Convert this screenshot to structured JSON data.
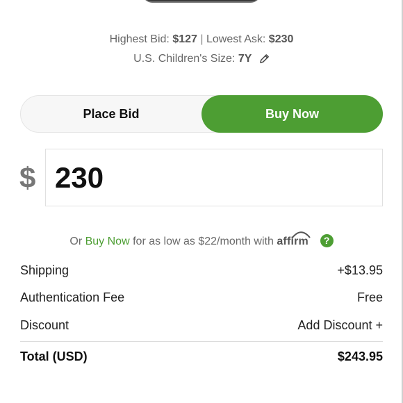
{
  "info": {
    "highest_bid_label": "Highest Bid:",
    "highest_bid_value": "$127",
    "lowest_ask_label": "Lowest Ask:",
    "lowest_ask_value": "$230",
    "size_label": "U.S. Children's Size:",
    "size_value": "7Y"
  },
  "toggle": {
    "place_bid_label": "Place Bid",
    "buy_now_label": "Buy Now",
    "selected": "Buy Now"
  },
  "amount": {
    "currency_symbol": "$",
    "value": "230"
  },
  "affirm": {
    "prefix": "Or",
    "link": "Buy Now",
    "middle": "for as low as $22/month with",
    "brand": "affirm",
    "help_glyph": "?"
  },
  "fees": {
    "shipping_label": "Shipping",
    "shipping_value": "+$13.95",
    "auth_label": "Authentication Fee",
    "auth_value": "Free",
    "discount_label": "Discount",
    "discount_action": "Add Discount +",
    "total_label": "Total (USD)",
    "total_value": "$243.95"
  },
  "colors": {
    "accent": "#4d9e33",
    "muted_text": "#666666"
  },
  "icons": {
    "edit_size": "pencil-icon",
    "help": "question-circle-icon"
  }
}
